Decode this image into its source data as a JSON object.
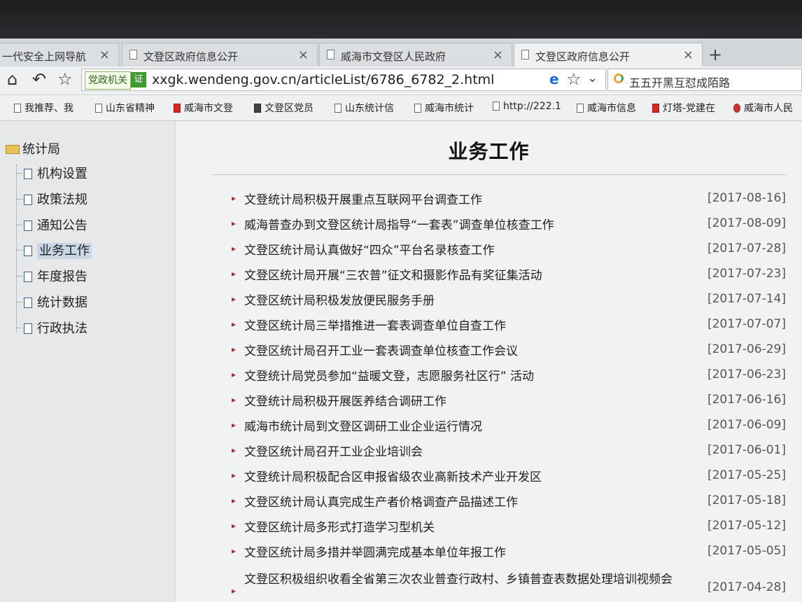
{
  "tabs": [
    {
      "label": "一代安全上网导航",
      "close": "×"
    },
    {
      "label": "文登区政府信息公开",
      "close": "×"
    },
    {
      "label": "威海市文登区人民政府",
      "close": "×"
    },
    {
      "label": "文登区政府信息公开",
      "close": "×"
    }
  ],
  "new_tab": "+",
  "nav": {
    "badge": "党政机关",
    "badge_icon": "证",
    "url": "xxgk.wendeng.gov.cn/articleList/6786_6782_2.html",
    "search_text": "五五开黑互怼成陌路"
  },
  "bookmarks": [
    "我推荐、我",
    "山东省精神",
    "威海市文登",
    "文登区党员",
    "山东统计信",
    "威海市统计",
    "http://222.1",
    "威海市信息",
    "灯塔-党建在",
    "威海市人民"
  ],
  "sidebar": {
    "root": "统计局",
    "items": [
      "机构设置",
      "政策法规",
      "通知公告",
      "业务工作",
      "年度报告",
      "统计数据",
      "行政执法"
    ]
  },
  "main": {
    "title": "业务工作",
    "articles": [
      {
        "title": "文登统计局积极开展重点互联网平台调查工作",
        "date": "[2017-08-16]"
      },
      {
        "title": "威海普查办到文登区统计局指导“一套表”调查单位核查工作",
        "date": "[2017-08-09]"
      },
      {
        "title": "文登区统计局认真做好“四众”平台名录核查工作",
        "date": "[2017-07-28]"
      },
      {
        "title": "文登区统计局开展“三农普”征文和摄影作品有奖征集活动",
        "date": "[2017-07-23]"
      },
      {
        "title": "文登区统计局积极发放便民服务手册",
        "date": "[2017-07-14]"
      },
      {
        "title": "文登区统计局三举措推进一套表调查单位自查工作",
        "date": "[2017-07-07]"
      },
      {
        "title": "文登区统计局召开工业一套表调查单位核查工作会议",
        "date": "[2017-06-29]"
      },
      {
        "title": "文登统计局党员参加“益暖文登，志愿服务社区行” 活动",
        "date": "[2017-06-23]"
      },
      {
        "title": "文登统计局积极开展医养结合调研工作",
        "date": "[2017-06-16]"
      },
      {
        "title": "威海市统计局到文登区调研工业企业运行情况",
        "date": "[2017-06-09]"
      },
      {
        "title": "文登区统计局召开工业企业培训会",
        "date": "[2017-06-01]"
      },
      {
        "title": "文登统计局积极配合区申报省级农业高新技术产业开发区",
        "date": "[2017-05-25]"
      },
      {
        "title": "文登区统计局认真完成生产者价格调查产品描述工作",
        "date": "[2017-05-18]"
      },
      {
        "title": "文登区统计局多形式打造学习型机关",
        "date": "[2017-05-12]"
      },
      {
        "title": "文登区统计局多措并举圆满完成基本单位年报工作",
        "date": "[2017-05-05]"
      },
      {
        "title": "文登区积极组织收看全省第三次农业普查行政村、乡镇普查表数据处理培训视频会",
        "date": "[2017-04-28]"
      }
    ]
  }
}
